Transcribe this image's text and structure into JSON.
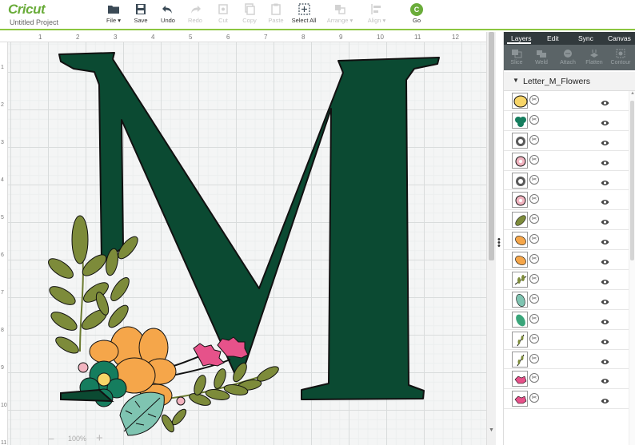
{
  "app": {
    "logo": "Cricut",
    "project_title": "Untitled Project"
  },
  "toolbar": [
    {
      "name": "file",
      "label": "File ▾",
      "icon": "folder-icon",
      "enabled": true
    },
    {
      "name": "save",
      "label": "Save",
      "icon": "save-icon",
      "enabled": true
    },
    {
      "name": "undo",
      "label": "Undo",
      "icon": "undo-icon",
      "enabled": true
    },
    {
      "name": "redo",
      "label": "Redo",
      "icon": "redo-icon",
      "enabled": false
    },
    {
      "name": "cut",
      "label": "Cut",
      "icon": "cut-icon",
      "enabled": false
    },
    {
      "name": "copy",
      "label": "Copy",
      "icon": "copy-icon",
      "enabled": false
    },
    {
      "name": "paste",
      "label": "Paste",
      "icon": "paste-icon",
      "enabled": false
    },
    {
      "name": "select-all",
      "label": "Select All",
      "icon": "select-all-icon",
      "enabled": true
    },
    {
      "name": "arrange",
      "label": "Arrange ▾",
      "icon": "arrange-icon",
      "enabled": false
    },
    {
      "name": "align",
      "label": "Align ▾",
      "icon": "align-icon",
      "enabled": false
    }
  ],
  "go": {
    "badge": "C",
    "label": "Go"
  },
  "ruler": {
    "top": [
      "1",
      "2",
      "3",
      "4",
      "5",
      "6",
      "7",
      "8",
      "9",
      "10",
      "11",
      "12"
    ],
    "left": [
      "1",
      "2",
      "3",
      "4",
      "5",
      "6",
      "7",
      "8",
      "9",
      "10",
      "11"
    ]
  },
  "canvas": {
    "letter_color": "#0b4a32",
    "zoom": "100%",
    "zoom_minus": "−",
    "zoom_plus": "+"
  },
  "panel": {
    "tabs": [
      "Layers",
      "Edit",
      "Sync",
      "Canvas"
    ],
    "actions": [
      {
        "label": "Slice",
        "icon": "slice-icon"
      },
      {
        "label": "Weld",
        "icon": "weld-icon"
      },
      {
        "label": "Attach",
        "icon": "attach-icon"
      },
      {
        "label": "Flatten",
        "icon": "flatten-icon"
      },
      {
        "label": "Contour",
        "icon": "contour-icon"
      }
    ],
    "group_name": "Letter_M_Flowers",
    "layers": [
      {
        "thumb": "yellow-circle",
        "color": "#f7d568"
      },
      {
        "thumb": "teal-flower",
        "color": "#157d5e"
      },
      {
        "thumb": "print-blob",
        "color": "#222222"
      },
      {
        "thumb": "pink-flower",
        "color": "#f2b4c0"
      },
      {
        "thumb": "print-blob",
        "color": "#222222"
      },
      {
        "thumb": "pink-flower",
        "color": "#f2b4c0"
      },
      {
        "thumb": "olive-leaf",
        "color": "#7d8b3a"
      },
      {
        "thumb": "orange-petal",
        "color": "#f5a64a"
      },
      {
        "thumb": "orange-petal",
        "color": "#f5a64a"
      },
      {
        "thumb": "olive-sprig",
        "color": "#7d8b3a"
      },
      {
        "thumb": "teal-leaf",
        "color": "#7fc4b1"
      },
      {
        "thumb": "green-leaf",
        "color": "#3aa57a"
      },
      {
        "thumb": "olive-stem",
        "color": "#7d8b3a"
      },
      {
        "thumb": "olive-stem",
        "color": "#7d8b3a"
      },
      {
        "thumb": "pink-bloom",
        "color": "#e6528a"
      },
      {
        "thumb": "pink-bloom",
        "color": "#e6528a"
      }
    ]
  }
}
